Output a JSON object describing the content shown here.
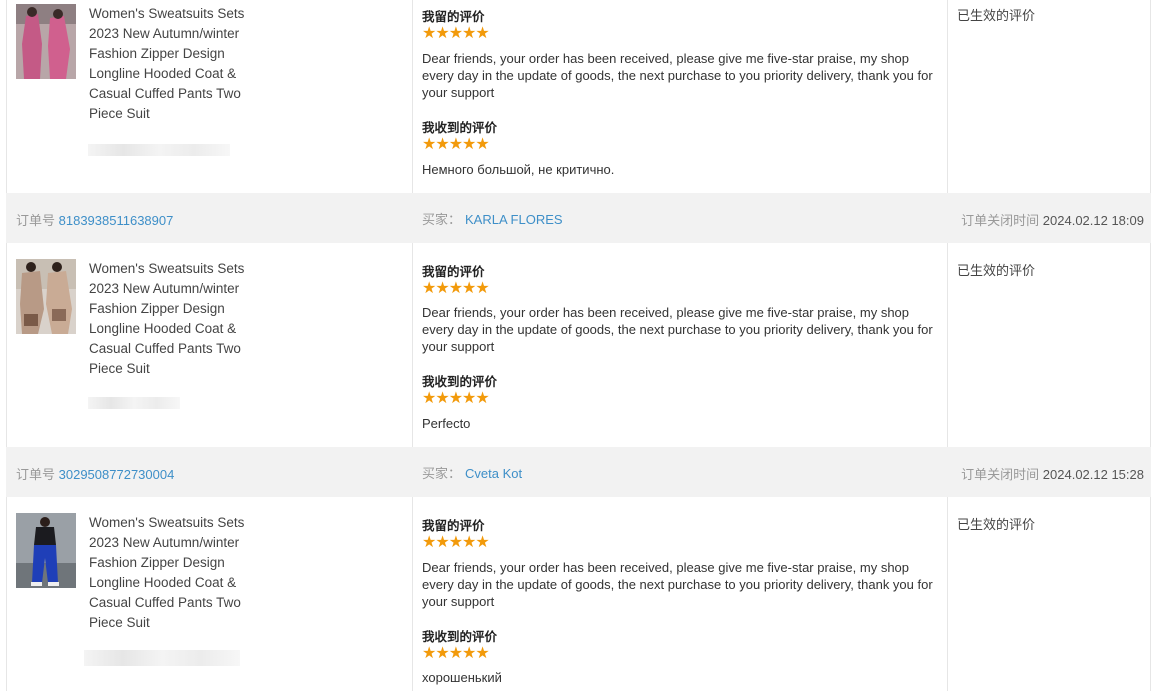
{
  "labels": {
    "order_no": "订单号",
    "buyer": "买家：",
    "closed_time": "订单关闭时间",
    "my_review": "我留的评价",
    "received_review": "我收到的评价",
    "status": "已生效的评价",
    "stars": "★★★★★"
  },
  "product_title": "Women's Sweatsuits Sets 2023 New Autumn/winter Fashion Zipper Design Longline Hooded Coat & Casual Cuffed Pants Two Piece Suit",
  "seller_message": "Dear friends, your order has been received, please give me five-star praise, my shop every day in the update of goods, the next purchase to you priority delivery, thank you for your support",
  "orders": [
    {
      "order_number": "",
      "buyer": "",
      "closed_time": "",
      "received_comment": "Немного большой, не критично.",
      "my_rating": 5,
      "received_rating": 5
    },
    {
      "order_number": "8183938511638907",
      "buyer": "KARLA FLORES",
      "closed_time": "2024.02.12 18:09",
      "received_comment": "Perfecto",
      "my_rating": 5,
      "received_rating": 5
    },
    {
      "order_number": "3029508772730004",
      "buyer": "Cveta Kot",
      "closed_time": "2024.02.12 15:28",
      "received_comment": "хорошенький",
      "my_rating": 5,
      "received_rating": 5
    }
  ],
  "colors": {
    "link": "#3e8fc8",
    "star": "#f29a0b",
    "header_bg": "#f2f2f2"
  }
}
